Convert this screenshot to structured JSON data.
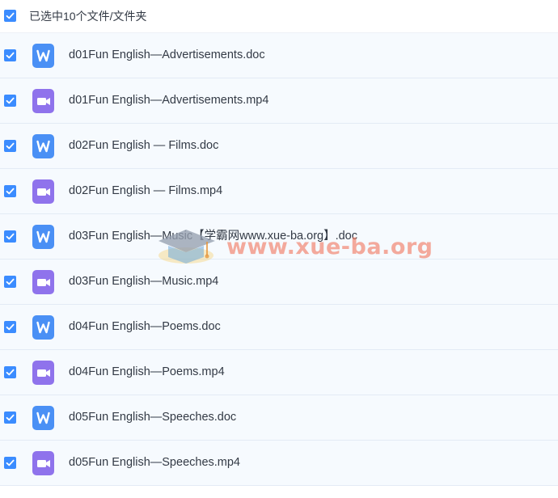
{
  "header": {
    "selection_text": "已选中10个文件/文件夹",
    "checked": true
  },
  "files": [
    {
      "name": "d01Fun English—Advertisements.doc",
      "type": "doc",
      "icon": "word-doc-icon",
      "checked": true
    },
    {
      "name": "d01Fun English—Advertisements.mp4",
      "type": "mp4",
      "icon": "video-file-icon",
      "checked": true
    },
    {
      "name": "d02Fun English — Films.doc",
      "type": "doc",
      "icon": "word-doc-icon",
      "checked": true
    },
    {
      "name": "d02Fun English — Films.mp4",
      "type": "mp4",
      "icon": "video-file-icon",
      "checked": true
    },
    {
      "name": "d03Fun English—Music【学霸网www.xue-ba.org】.doc",
      "type": "doc",
      "icon": "word-doc-icon",
      "checked": true
    },
    {
      "name": "d03Fun English—Music.mp4",
      "type": "mp4",
      "icon": "video-file-icon",
      "checked": true
    },
    {
      "name": "d04Fun English—Poems.doc",
      "type": "doc",
      "icon": "word-doc-icon",
      "checked": true
    },
    {
      "name": "d04Fun English—Poems.mp4",
      "type": "mp4",
      "icon": "video-file-icon",
      "checked": true
    },
    {
      "name": "d05Fun English—Speeches.doc",
      "type": "doc",
      "icon": "word-doc-icon",
      "checked": true
    },
    {
      "name": "d05Fun English—Speeches.mp4",
      "type": "mp4",
      "icon": "video-file-icon",
      "checked": true
    }
  ],
  "watermark": {
    "text": "www.xue-ba.org",
    "icon": "graduation-cap-icon"
  },
  "colors": {
    "checkbox": "#3b8cff",
    "doc_icon": "#4a90f5",
    "video_icon": "#8f73ec",
    "row_background": "#f6fafe",
    "watermark": "#f0785f"
  }
}
